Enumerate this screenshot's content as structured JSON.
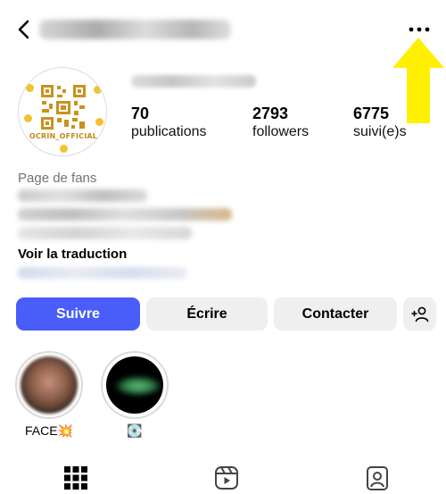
{
  "header": {
    "back_icon": "chevron-left-icon",
    "more_icon": "more-horizontal-icon"
  },
  "profile": {
    "avatar_label": "OCRIN_OFFICIAL",
    "stats": [
      {
        "value": "70",
        "label": "publications"
      },
      {
        "value": "2793",
        "label": "followers"
      },
      {
        "value": "6775",
        "label": "suivi(e)s"
      }
    ],
    "category": "Page de fans",
    "translate_link": "Voir la traduction"
  },
  "actions": {
    "follow": "Suivre",
    "message": "Écrire",
    "contact": "Contacter",
    "add_user_icon": "person-plus-icon"
  },
  "highlights": [
    {
      "label": "FACE💥"
    },
    {
      "label": "💽"
    }
  ],
  "tabs": [
    {
      "icon": "grid-icon"
    },
    {
      "icon": "reels-icon"
    },
    {
      "icon": "tagged-icon"
    }
  ],
  "colors": {
    "accent": "#4a5df9",
    "secondary_button": "#efefef",
    "annotation_arrow": "#ffef00",
    "muted_text": "#737373"
  }
}
